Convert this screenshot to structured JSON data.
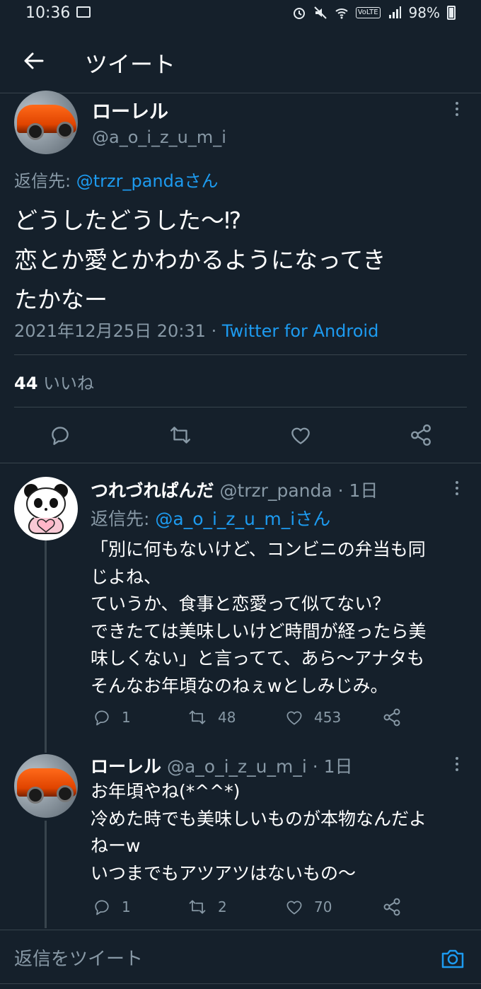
{
  "status_bar": {
    "time": "10:36",
    "battery": "98%",
    "volte": "VoLTE"
  },
  "header": {
    "title": "ツイート"
  },
  "main_tweet": {
    "name": "ローレル",
    "handle": "@a_o_i_z_u_m_i",
    "reply_to_label": "返信先: ",
    "reply_to_user": "@trzr_pandaさん",
    "text_lines": [
      "どうしたどうした～⁉",
      "恋とか愛とかわかるようになってき",
      "たかなー"
    ],
    "timestamp": "2021年12月25日 20:31",
    "separator": " · ",
    "source": "Twitter for Android",
    "likes_count": "44",
    "likes_label": "いいね"
  },
  "replies": [
    {
      "name": "つれづれぱんだ",
      "handle": "@trzr_panda",
      "time": " · 1日",
      "reply_to_label": "返信先: ",
      "reply_to_user": "@a_o_i_z_u_m_iさん",
      "text_lines": [
        "「別に何もないけど、コンビニの弁当も同",
        "じよね、",
        "ていうか、食事と恋愛って似てない？",
        "できたては美味しいけど時間が経ったら美",
        "味しくない」と言ってて、あら～アナタも",
        "そんなお年頃なのねぇwとしみじみ。"
      ],
      "replies": "1",
      "retweets": "48",
      "likes": "453"
    },
    {
      "name": "ローレル",
      "handle": "@a_o_i_z_u_m_i",
      "time": " · 1日",
      "text_lines": [
        "お年頃やね(*^^*)",
        "冷めた時でも美味しいものが本物なんだよ",
        "ねーw",
        "いつまでもアツアツはないもの～"
      ],
      "replies": "1",
      "retweets": "2",
      "likes": "70"
    }
  ],
  "compose": {
    "placeholder": "返信をツイート"
  },
  "colors": {
    "background": "#15202b",
    "accent": "#1d9bf0",
    "muted": "#8899a6",
    "divider": "#38444d"
  }
}
